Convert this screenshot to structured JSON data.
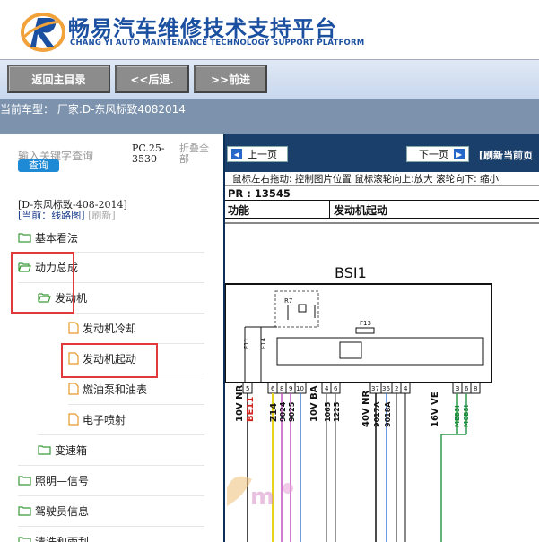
{
  "header": {
    "title_cn": "畅易汽车维修技术支持平台",
    "title_en": "CHANG YI AUTO MAINTENANCE TECHNOLOGY SUPPORT PLATFORM",
    "logo_icon": "stylized-r-swoosh-logo"
  },
  "toolbar": {
    "home_label": "返回主目录",
    "back_label": "<<后退.",
    "forward_label": ">>前进"
  },
  "model_bar": {
    "text": "当前车型： 厂家:D-东风标致4082014"
  },
  "left": {
    "search_placeholder": "输入关键字查询",
    "query_label": "查询",
    "pc_code": "PC.25-3530",
    "collapse_all": "折叠全部",
    "model_line": "[D-东风标致-408-2014]",
    "current_prefix": "[当前：",
    "current_value": "线路图]",
    "refresh": "[刷新]",
    "tree": [
      {
        "label": "基本看法",
        "type": "folder"
      },
      {
        "label": "动力总成",
        "type": "folder-open"
      },
      {
        "label": "发动机",
        "type": "folder-open"
      },
      {
        "label": "发动机冷却",
        "type": "file"
      },
      {
        "label": "发动机起动",
        "type": "file"
      },
      {
        "label": "燃油泵和油表",
        "type": "file"
      },
      {
        "label": "电子喷射",
        "type": "file"
      },
      {
        "label": "变速箱",
        "type": "folder"
      },
      {
        "label": "照明—信号",
        "type": "folder"
      },
      {
        "label": "驾驶员信息",
        "type": "folder"
      },
      {
        "label": "清洗和雨刮",
        "type": "folder"
      }
    ]
  },
  "right": {
    "prev_label": "上一页",
    "next_label": "下一页",
    "refresh_label": "[刷新当前页",
    "hint": "鼠标左右拖动: 控制图片位置  鼠标滚轮向上:放大  滚轮向下: 缩小",
    "pr_label": "PR : 13545",
    "col_function": "功能",
    "function_value": "发动机起动",
    "diagram": {
      "module": "BSI1",
      "fuse_a": "F13",
      "fuse_b": "F14",
      "fuse_c": "F11",
      "relay": "R7",
      "pins": [
        "5",
        "6",
        "8",
        "9",
        "10",
        "4",
        "6",
        "37",
        "36",
        "2",
        "4",
        "3",
        "6",
        "8"
      ],
      "wire_labels": [
        "10V NR",
        "BE11",
        "Z14",
        "9024",
        "9025",
        "10V BA",
        "1065",
        "1225",
        "40V NR",
        "9017A",
        "9018A",
        "16V VE",
        "MEBSI",
        "MCBSI"
      ]
    },
    "colors": {
      "nav_bg": "#1a3f6b",
      "accent_red": "#e03a3a",
      "folder_green": "#3a9a3a",
      "file_orange": "#e79a2a"
    }
  }
}
